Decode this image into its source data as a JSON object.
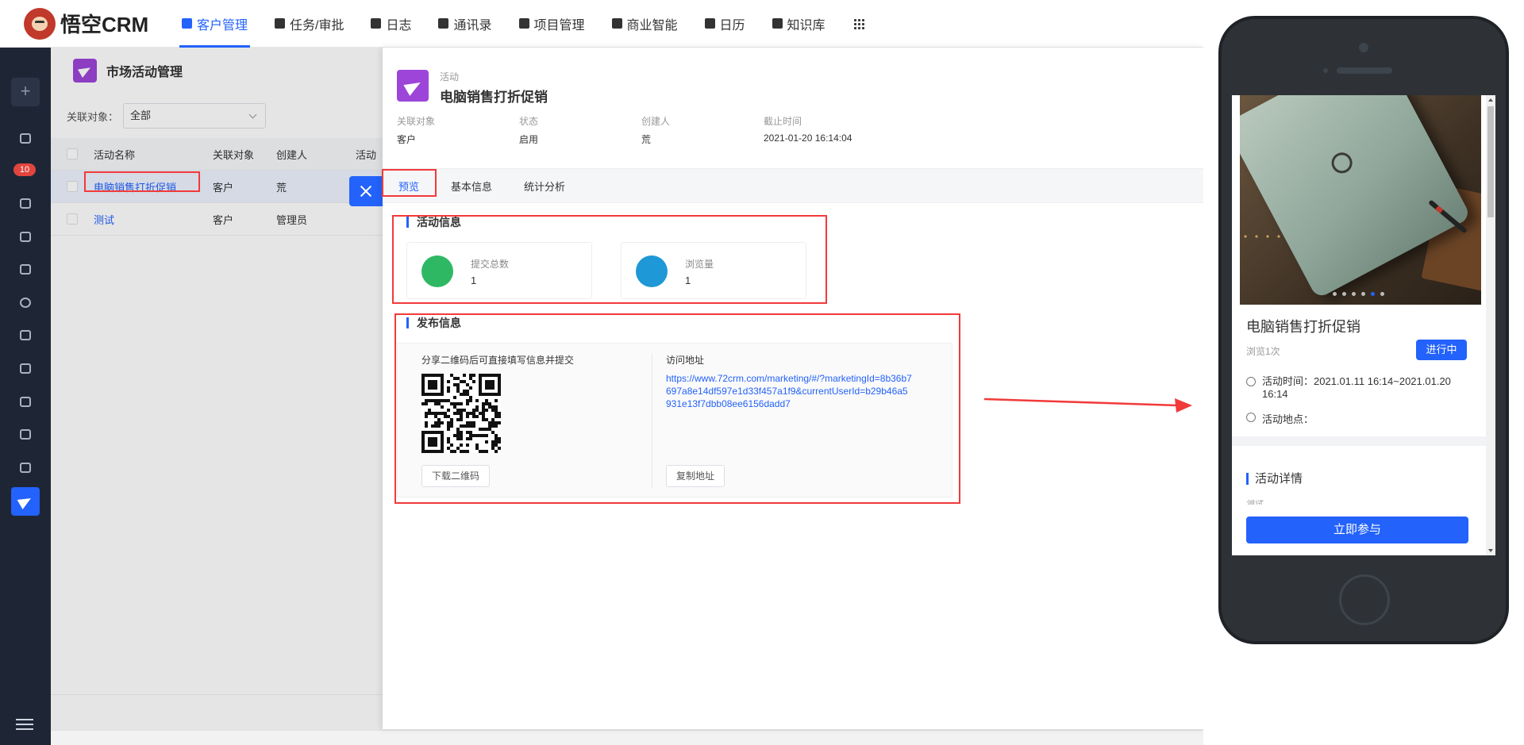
{
  "app": {
    "logo_text": "悟空CRM"
  },
  "topnav": {
    "items": [
      {
        "label": "客户管理",
        "icon": "building-icon",
        "active": true
      },
      {
        "label": "任务/审批",
        "icon": "briefcase-icon"
      },
      {
        "label": "日志",
        "icon": "journal-icon"
      },
      {
        "label": "通讯录",
        "icon": "phonebook-icon"
      },
      {
        "label": "项目管理",
        "icon": "list-icon"
      },
      {
        "label": "商业智能",
        "icon": "shield-icon"
      },
      {
        "label": "日历",
        "icon": "calendar-icon"
      },
      {
        "label": "知识库",
        "icon": "book-icon"
      }
    ],
    "more_icon": "grid-icon"
  },
  "sidebar": {
    "add_label": "+",
    "badge_count": "10",
    "icons": [
      "dashboard-icon",
      "badge-icon",
      "transfer-icon",
      "building-icon",
      "contact-icon",
      "money-icon",
      "contract-icon",
      "bag-icon",
      "product-icon",
      "home-icon",
      "box-icon",
      "marketing-icon"
    ]
  },
  "list": {
    "title": "市场活动管理",
    "filter_label": "关联对象：",
    "filter_value": "全部",
    "columns": [
      "活动名称",
      "关联对象",
      "创建人",
      "活动"
    ],
    "rows": [
      {
        "name": "电脑销售打折促销",
        "target": "客户",
        "creator": "荒"
      },
      {
        "name": "测试",
        "target": "客户",
        "creator": "管理员"
      }
    ]
  },
  "detail": {
    "type_label": "活动",
    "name": "电脑销售打折促销",
    "meta": [
      {
        "k": "关联对象",
        "v": "客户"
      },
      {
        "k": "状态",
        "v": "启用"
      },
      {
        "k": "创建人",
        "v": "荒"
      },
      {
        "k": "截止时间",
        "v": "2021-01-20 16:14:04"
      }
    ],
    "tabs": [
      "预览",
      "基本信息",
      "统计分析"
    ],
    "activity_section": "活动信息",
    "stats": [
      {
        "label": "提交总数",
        "value": "1",
        "color": "#2fb864",
        "icon": "eye-icon"
      },
      {
        "label": "浏览量",
        "value": "1",
        "color": "#1e98d6",
        "icon": "bar-chart-icon"
      }
    ],
    "publish_section": "发布信息",
    "qr_label": "分享二维码后可直接填写信息并提交",
    "download_qr": "下载二维码",
    "url_label": "访问地址",
    "url": "https://www.72crm.com/marketing/#/?marketingId=8b36b7697a8e14df597e1d33f457a1f9&currentUserId=b29b46a5931e13f7dbb08ee6156dadd7",
    "copy_url": "复制地址"
  },
  "mobile": {
    "title": "电脑销售打折促销",
    "views": "浏览1次",
    "status_badge": "进行中",
    "time": "活动时间：2021.01.11 16:14~2021.01.20 16:14",
    "location": "活动地点：",
    "detail_section": "活动详情",
    "cut_text": "测试",
    "cta": "立即参与"
  },
  "colors": {
    "accent": "#2362fb",
    "annotation": "#f23a3a",
    "sidebar": "#1e2636"
  }
}
